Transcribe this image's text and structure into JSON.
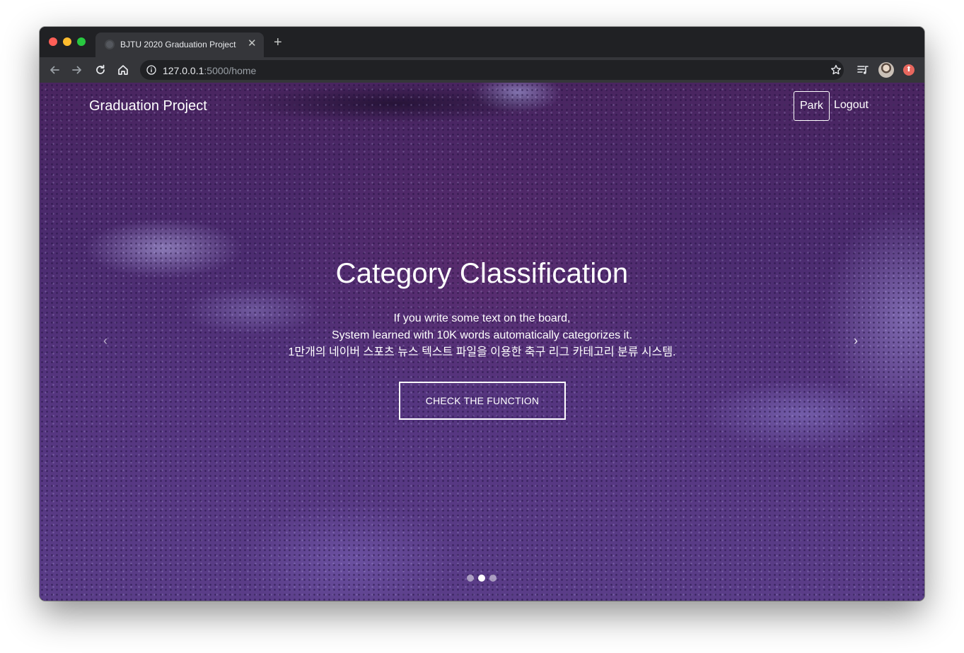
{
  "browser": {
    "tab_title": "BJTU 2020 Graduation Project",
    "tab_close": "✕",
    "new_tab": "+",
    "url_host": "127.0.0.1",
    "url_rest": ":5000/home"
  },
  "navbar": {
    "brand": "Graduation Project",
    "user": "Park",
    "logout": "Logout"
  },
  "hero": {
    "title": "Category Classification",
    "lines": [
      "If you write some text on the board,",
      "System learned with 10K words automatically categorizes it.",
      "1만개의 네이버 스포츠 뉴스 텍스트 파일을 이용한 축구 리그 카테고리 분류 시스템."
    ],
    "cta_label": "CHECK THE FUNCTION"
  },
  "carousel": {
    "prev_glyph": "‹",
    "next_glyph": "›",
    "slide_count": 3,
    "active_index": 1
  },
  "colors": {
    "chrome_dark": "#202124",
    "chrome_toolbar": "#35363a",
    "hero_purple": "#4b2b6e",
    "text_white": "#ffffff"
  },
  "icons": [
    "back-arrow-icon",
    "forward-arrow-icon",
    "reload-icon",
    "home-icon",
    "info-icon",
    "star-icon",
    "media-queue-icon",
    "profile-avatar",
    "extension-icon"
  ]
}
